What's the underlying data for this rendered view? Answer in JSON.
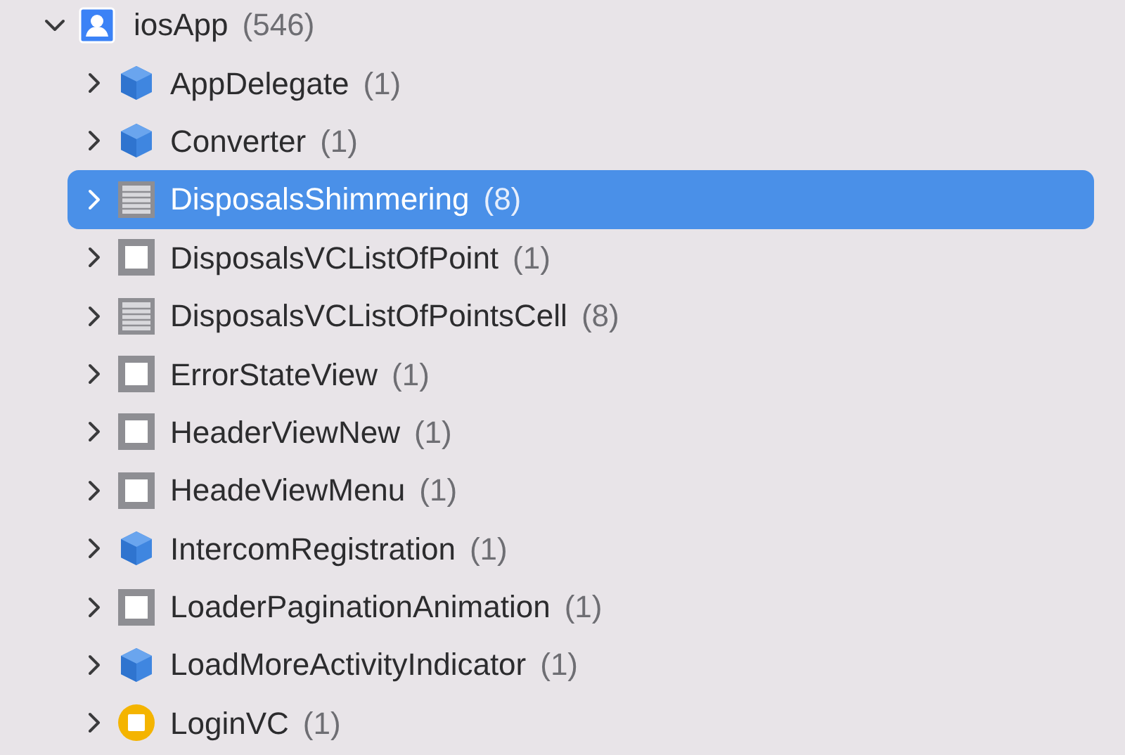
{
  "tree": {
    "name": "iosApp",
    "count": "(546)",
    "kind": "user",
    "expanded": true,
    "selected": false,
    "children": [
      {
        "name": "AppDelegate",
        "count": "(1)",
        "kind": "cube",
        "expanded": false,
        "selected": false
      },
      {
        "name": "Converter",
        "count": "(1)",
        "kind": "cube",
        "expanded": false,
        "selected": false
      },
      {
        "name": "DisposalsShimmering",
        "count": "(8)",
        "kind": "list",
        "expanded": false,
        "selected": true
      },
      {
        "name": "DisposalsVCListOfPoint",
        "count": "(1)",
        "kind": "view",
        "expanded": false,
        "selected": false
      },
      {
        "name": "DisposalsVCListOfPointsCell",
        "count": "(8)",
        "kind": "list",
        "expanded": false,
        "selected": false
      },
      {
        "name": "ErrorStateView",
        "count": "(1)",
        "kind": "view",
        "expanded": false,
        "selected": false
      },
      {
        "name": "HeaderViewNew",
        "count": "(1)",
        "kind": "view",
        "expanded": false,
        "selected": false
      },
      {
        "name": "HeadeViewMenu",
        "count": "(1)",
        "kind": "view",
        "expanded": false,
        "selected": false
      },
      {
        "name": "IntercomRegistration",
        "count": "(1)",
        "kind": "cube",
        "expanded": false,
        "selected": false
      },
      {
        "name": "LoaderPaginationAnimation",
        "count": "(1)",
        "kind": "view",
        "expanded": false,
        "selected": false
      },
      {
        "name": "LoadMoreActivityIndicator",
        "count": "(1)",
        "kind": "cube",
        "expanded": false,
        "selected": false
      },
      {
        "name": "LoginVC",
        "count": "(1)",
        "kind": "controller",
        "expanded": false,
        "selected": false
      }
    ]
  }
}
